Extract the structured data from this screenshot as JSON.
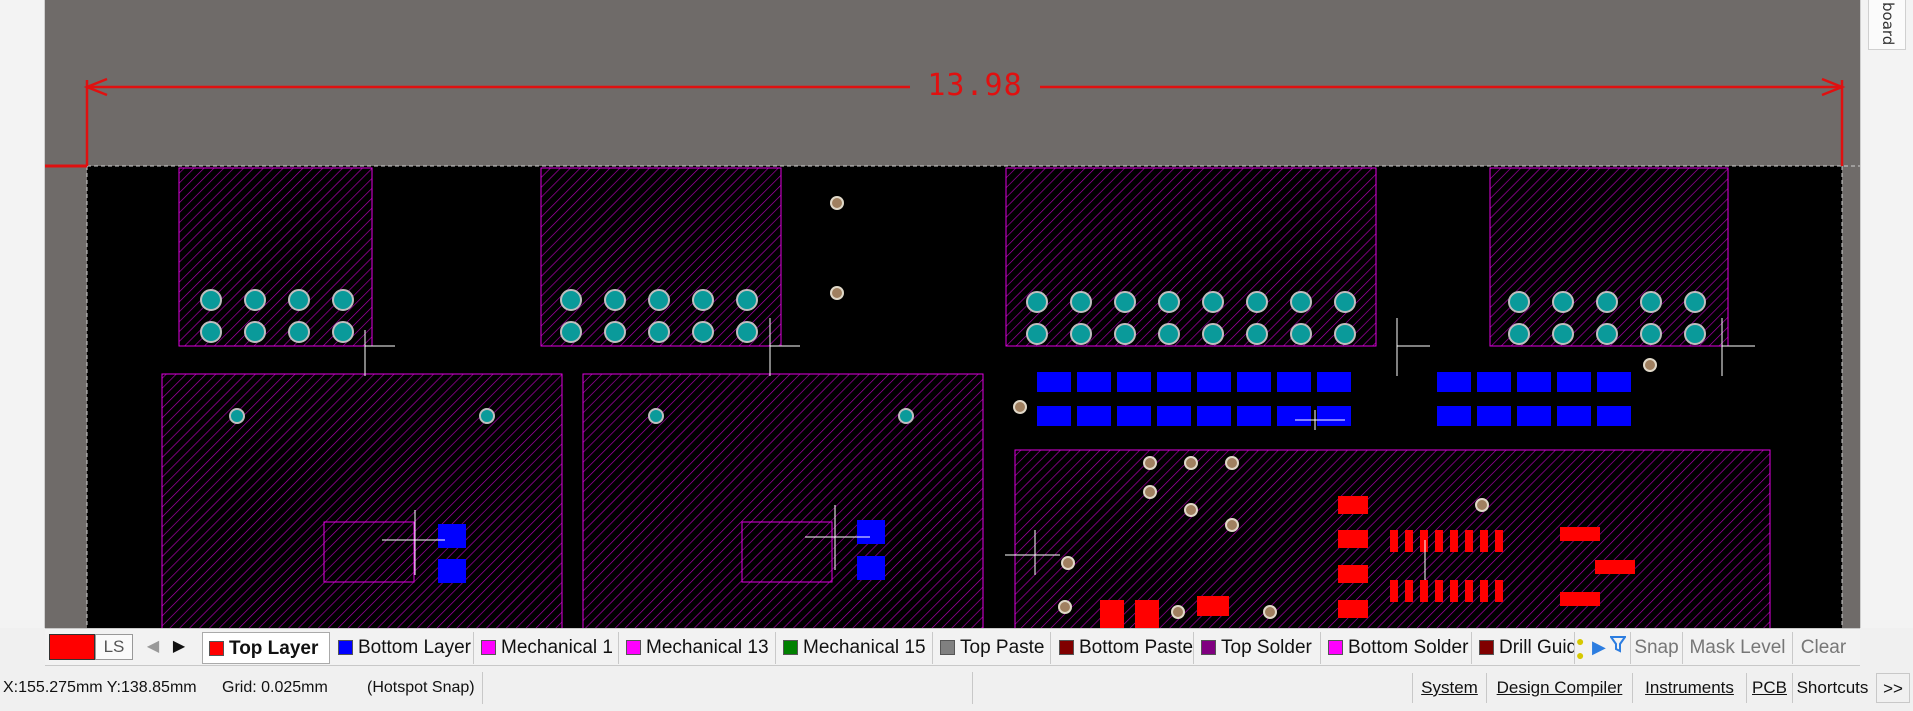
{
  "side_panel": {
    "tab_label": "board"
  },
  "canvas": {
    "dimension_label": "13.98",
    "colors": {
      "background": "#6f6b69",
      "board": "#000000",
      "top_layer": "#ff0000",
      "bottom_layer": "#0000ff",
      "mechanical": "#ff00ff",
      "pad": "#008b8b"
    }
  },
  "layer_bar": {
    "current_layer_short": "LS",
    "current_layer_color": "#ff0000",
    "tabs": [
      {
        "label": "Top Layer",
        "color": "#ff0000",
        "active": true
      },
      {
        "label": "Bottom Layer",
        "color": "#0000ff",
        "active": false
      },
      {
        "label": "Mechanical 1",
        "color": "#ff00ff",
        "active": false
      },
      {
        "label": "Mechanical 13",
        "color": "#ff00ff",
        "active": false
      },
      {
        "label": "Mechanical 15",
        "color": "#008000",
        "active": false
      },
      {
        "label": "Top Paste",
        "color": "#808080",
        "active": false
      },
      {
        "label": "Bottom Paste",
        "color": "#800000",
        "active": false
      },
      {
        "label": "Top Solder",
        "color": "#800080",
        "active": false
      },
      {
        "label": "Bottom Solder",
        "color": "#ff00ff",
        "active": false
      },
      {
        "label": "Drill Guid",
        "color": "#800000",
        "active": false
      }
    ],
    "buttons": {
      "snap": "Snap",
      "mask_level": "Mask Level",
      "clear": "Clear"
    },
    "icons": [
      "prev-layer-icon",
      "next-layer-icon",
      "lights-icon",
      "play-icon",
      "filter-icon"
    ]
  },
  "status_bar": {
    "coordinates": "X:155.275mm Y:138.85mm",
    "grid": "Grid: 0.025mm",
    "snap_mode": "(Hotspot Snap)",
    "panels": [
      "System",
      "Design Compiler",
      "Instruments",
      "PCB",
      "Shortcuts"
    ],
    "more": ">>"
  }
}
